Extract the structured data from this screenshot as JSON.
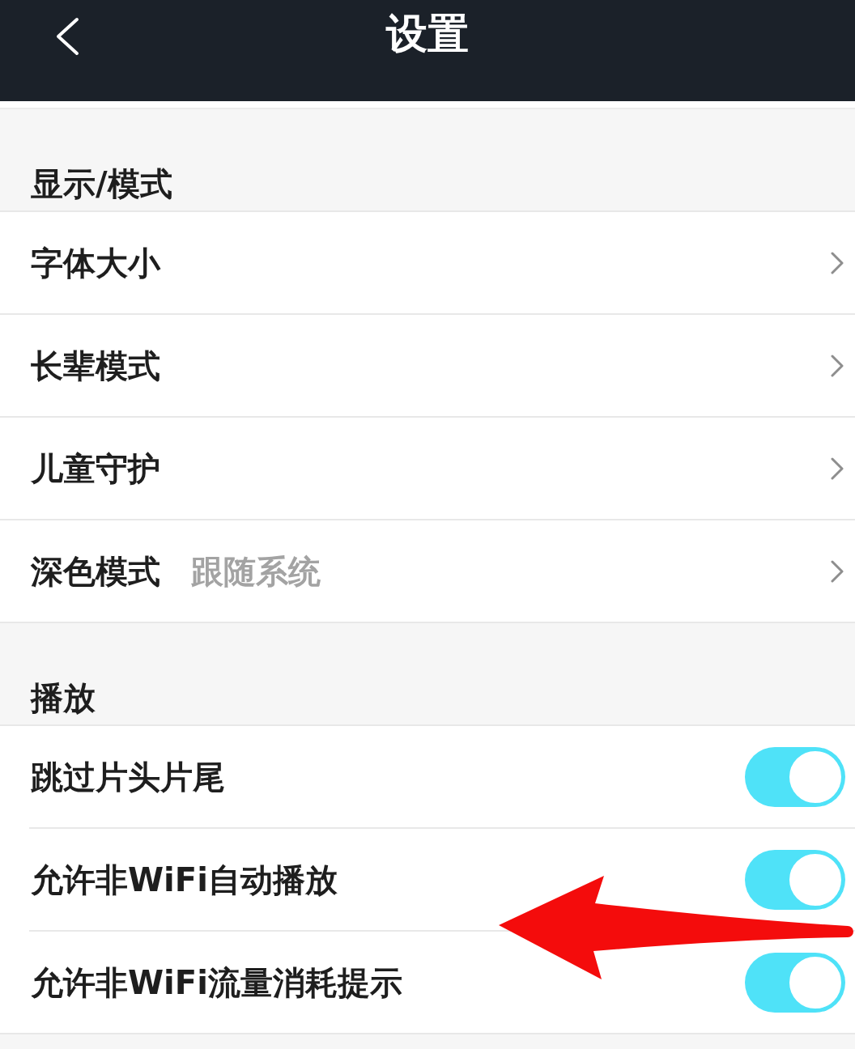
{
  "header": {
    "title": "设置"
  },
  "sections": [
    {
      "title": "显示/模式",
      "rows": [
        {
          "kind": "link",
          "label": "字体大小"
        },
        {
          "kind": "link",
          "label": "长辈模式"
        },
        {
          "kind": "link",
          "label": "儿童守护"
        },
        {
          "kind": "link",
          "label": "深色模式",
          "value": "跟随系统"
        }
      ]
    },
    {
      "title": "播放",
      "rows": [
        {
          "kind": "switch",
          "label": "跳过片头片尾",
          "on": true
        },
        {
          "kind": "switch",
          "label": "允许非WiFi自动播放",
          "on": true
        },
        {
          "kind": "switch",
          "label": "允许非WiFi流量消耗提示",
          "on": true
        }
      ]
    }
  ],
  "annotation": {
    "kind": "arrow"
  }
}
